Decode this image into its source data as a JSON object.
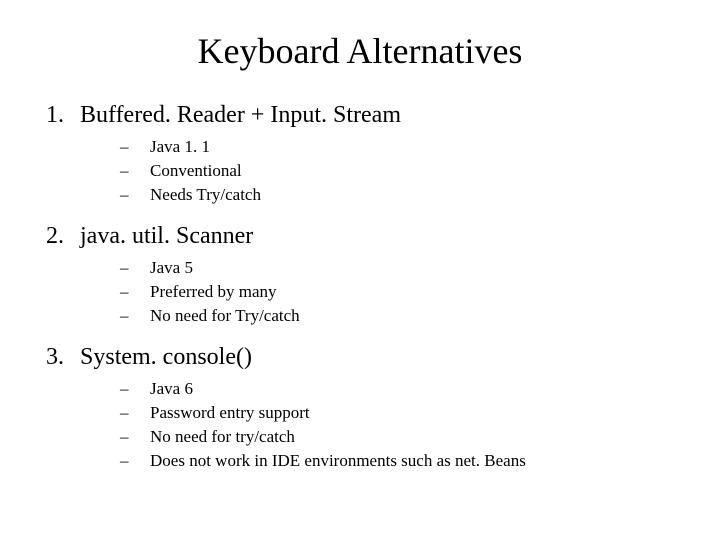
{
  "title": "Keyboard Alternatives",
  "items": [
    {
      "num": "1.",
      "label": "Buffered. Reader + Input. Stream",
      "subs": [
        "Java 1. 1",
        "Conventional",
        "Needs Try/catch"
      ]
    },
    {
      "num": "2.",
      "label": "java. util. Scanner",
      "subs": [
        "Java 5",
        "Preferred by many",
        "No need for Try/catch"
      ]
    },
    {
      "num": "3.",
      "label": "System. console()",
      "subs": [
        "Java 6",
        "Password entry support",
        "No need for try/catch",
        "Does not work in IDE environments such as net. Beans"
      ]
    }
  ],
  "dash": "–"
}
